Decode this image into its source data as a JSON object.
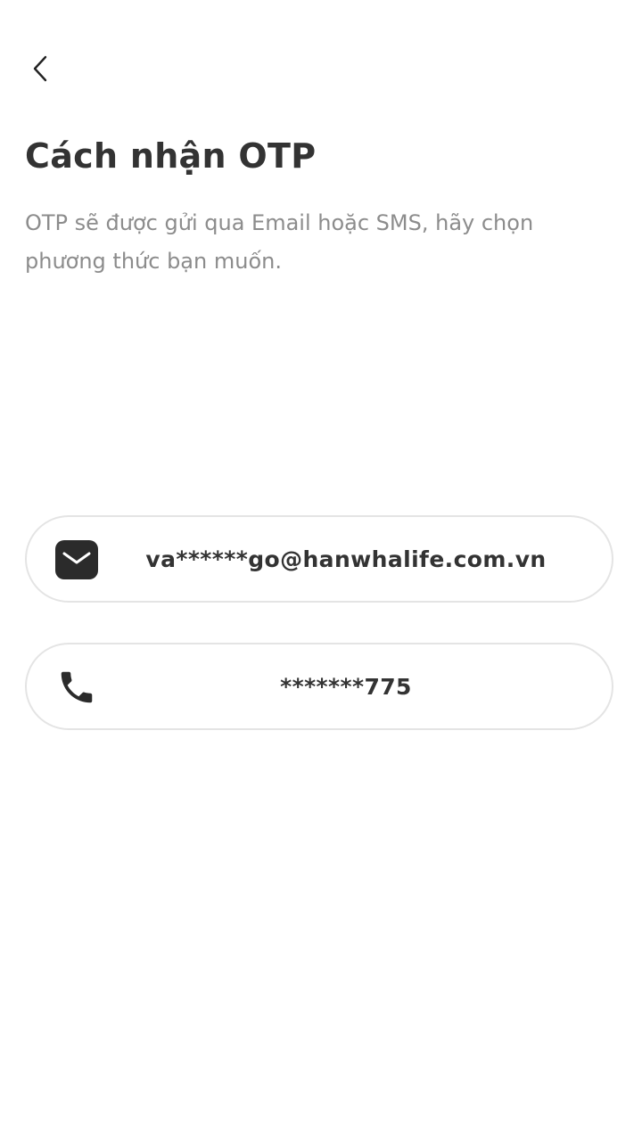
{
  "header": {
    "back_icon": "chevron-left-icon"
  },
  "main": {
    "title": "Cách nhận OTP",
    "subtitle": "OTP sẽ được gửi qua Email hoặc SMS, hãy chọn phương thức bạn muốn."
  },
  "options": [
    {
      "type": "email",
      "icon": "envelope-icon",
      "label": "va******go@hanwhalife.com.vn"
    },
    {
      "type": "sms",
      "icon": "phone-icon",
      "label": "*******775"
    }
  ],
  "colors": {
    "text_primary": "#333333",
    "text_secondary": "#8c8c8c",
    "border": "#e4e4e4",
    "background": "#ffffff"
  }
}
